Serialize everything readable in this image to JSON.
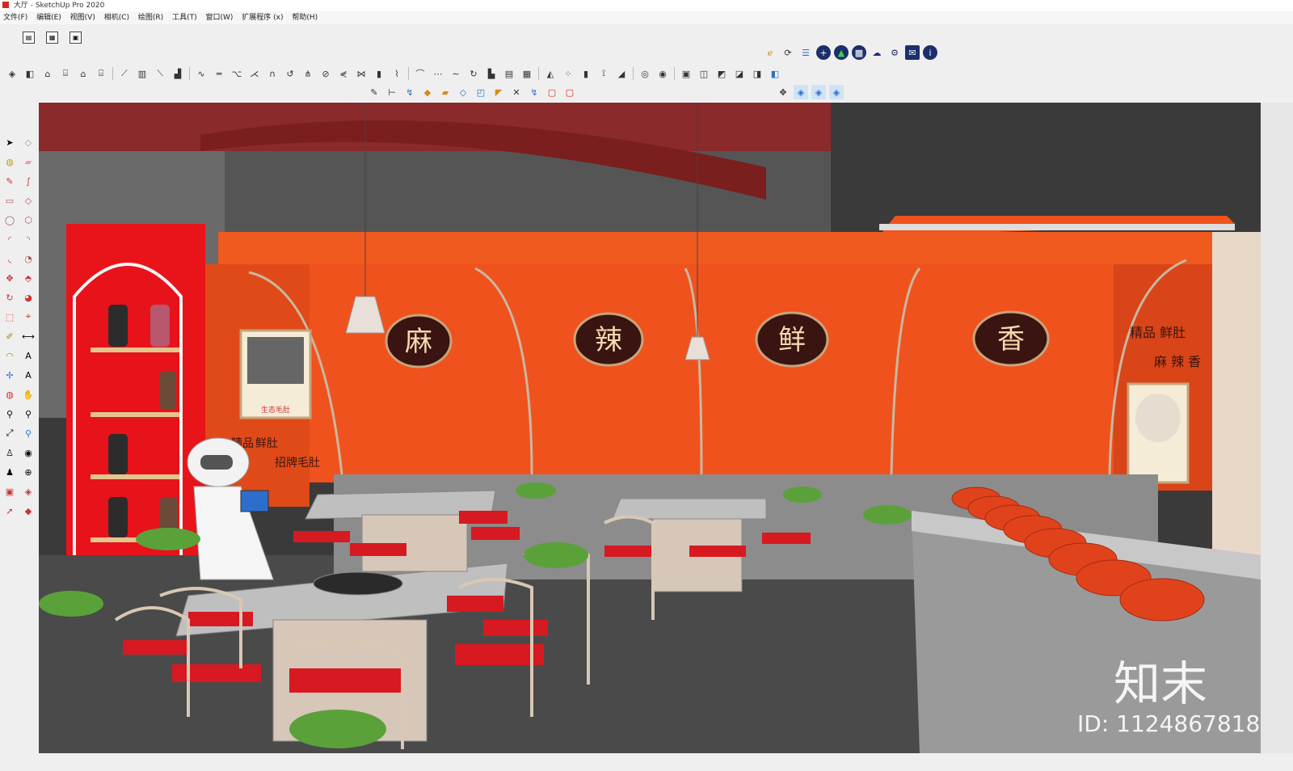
{
  "window": {
    "title": "大厅 - SketchUp Pro 2020"
  },
  "menu": [
    "文件(F)",
    "编辑(E)",
    "视图(V)",
    "相机(C)",
    "绘图(R)",
    "工具(T)",
    "窗口(W)",
    "扩展程序 (x)",
    "帮助(H)"
  ],
  "scene": {
    "sign_chars": [
      "麻",
      "辣",
      "鲜",
      "香"
    ],
    "poster_caption": "生态毛肚",
    "menu_text_left": [
      "精品",
      "鲜肚",
      "招牌毛肚"
    ],
    "menu_text_right": [
      "精品 鲜肚",
      "麻 辣 香"
    ]
  },
  "watermark": {
    "brand": "知末",
    "id_text": "ID: 1124867818"
  },
  "colors": {
    "accent": "#d9261c",
    "wall_orange": "#f0521d"
  }
}
